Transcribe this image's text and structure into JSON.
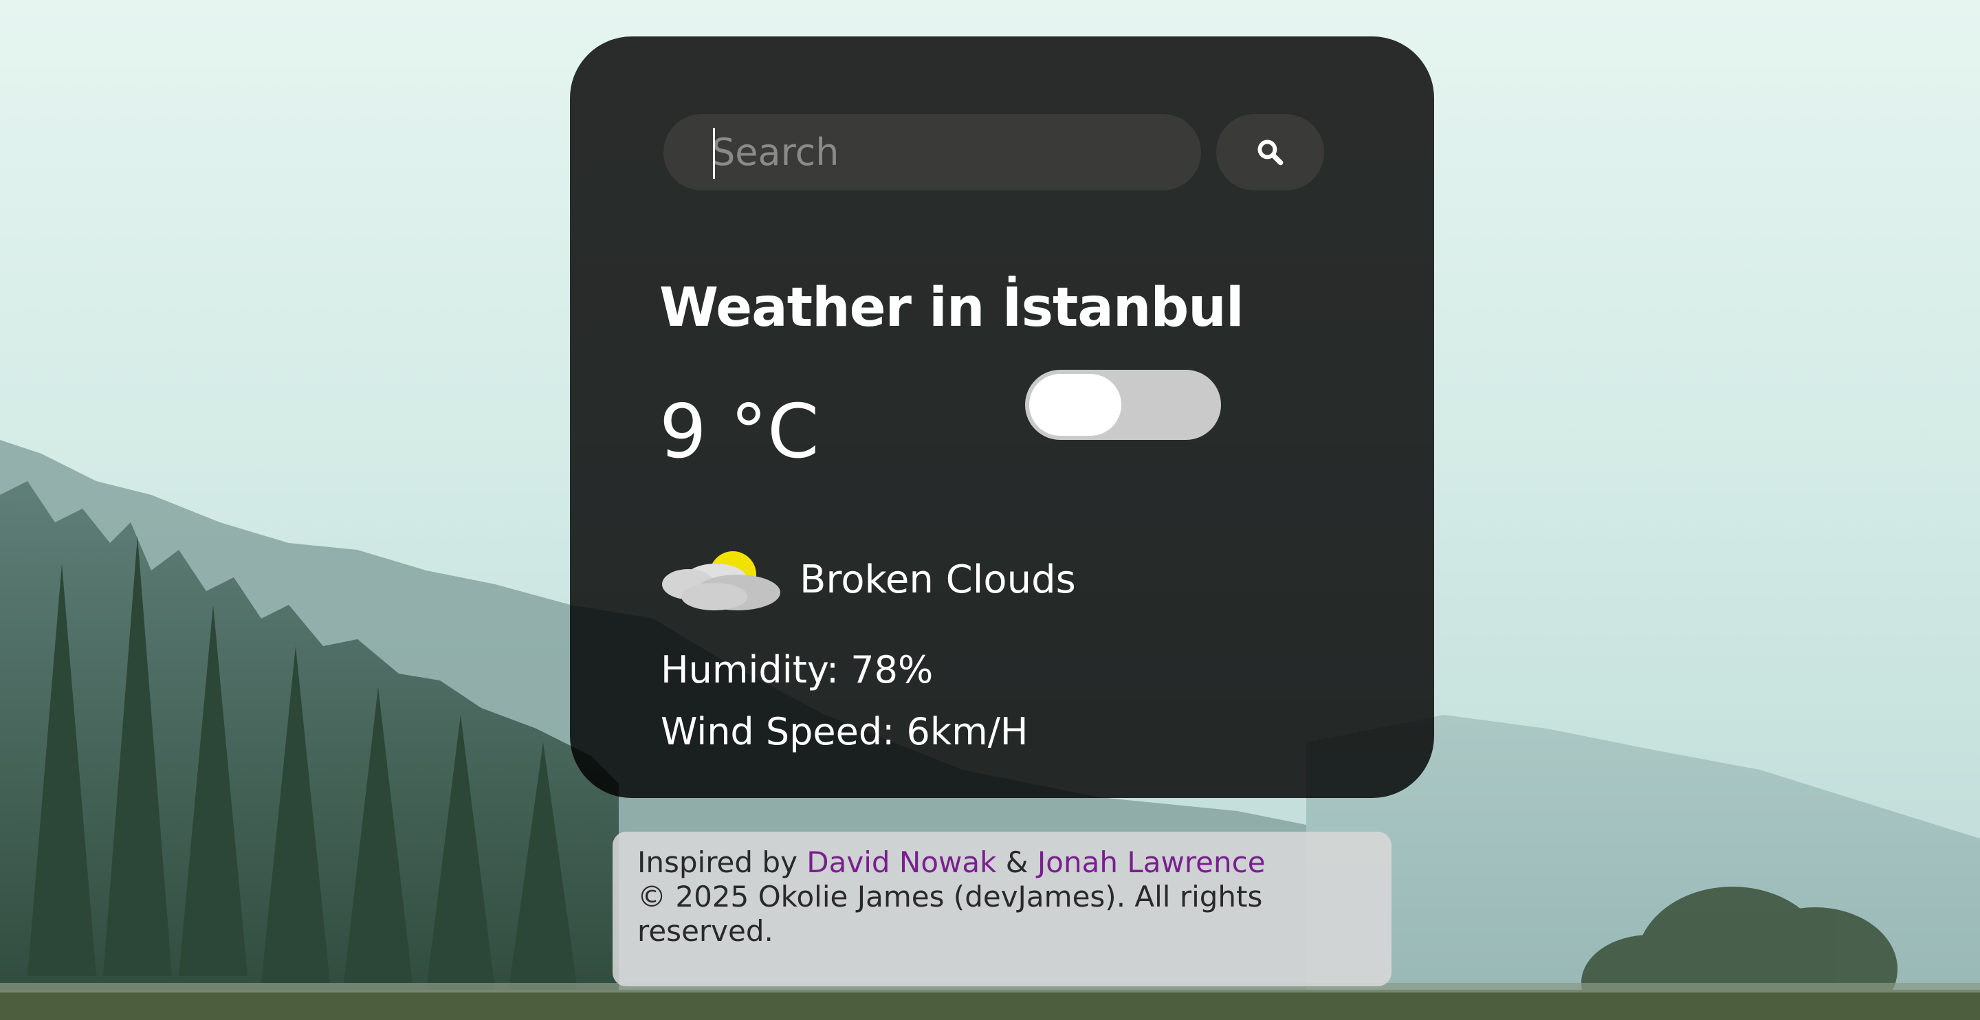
{
  "search": {
    "placeholder": "Search",
    "value": ""
  },
  "weather": {
    "title": "Weather in İstanbul",
    "temperature": "9 °C",
    "unit_toggle_on": false,
    "condition": "Broken Clouds",
    "condition_icon": "broken-clouds-icon",
    "humidity": "Humidity: 78%",
    "wind_speed": "Wind Speed: 6km/H"
  },
  "footer": {
    "inspired_prefix": "Inspired by",
    "author_1": "David Nowak",
    "ampersand": "&",
    "author_2": "Jonah Lawrence",
    "copyright": "© 2025 Okolie James (devJames). All rights reserved."
  },
  "colors": {
    "card_bg": "#1f201e",
    "link": "#7a1f8f",
    "toggle_track": "#cacaca",
    "sun": "#f2e200"
  }
}
